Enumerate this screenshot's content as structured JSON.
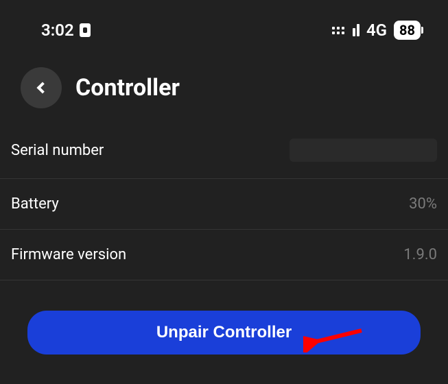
{
  "status_bar": {
    "time": "3:02",
    "network_label": "4G",
    "battery_percent": "88"
  },
  "header": {
    "title": "Controller"
  },
  "rows": {
    "serial": {
      "label": "Serial number",
      "value": ""
    },
    "battery": {
      "label": "Battery",
      "value": "30%"
    },
    "firmware": {
      "label": "Firmware version",
      "value": "1.9.0"
    }
  },
  "actions": {
    "unpair_label": "Unpair Controller"
  }
}
